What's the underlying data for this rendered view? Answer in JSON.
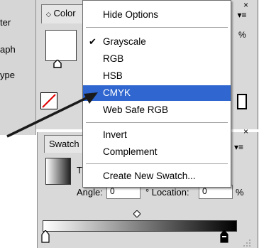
{
  "left_strip": {
    "items": [
      "ter",
      "aph",
      "ype"
    ]
  },
  "color_panel": {
    "tab_label": "Color",
    "percent": "%",
    "menu_glyph": "▾≡",
    "close_glyph": "×"
  },
  "menu": {
    "items": [
      {
        "label": "Hide Options",
        "checked": false,
        "active": false
      },
      {
        "label": "Grayscale",
        "checked": true,
        "active": false
      },
      {
        "label": "RGB",
        "checked": false,
        "active": false
      },
      {
        "label": "HSB",
        "checked": false,
        "active": false
      },
      {
        "label": "CMYK",
        "checked": false,
        "active": true
      },
      {
        "label": "Web Safe RGB",
        "checked": false,
        "active": false
      },
      {
        "label": "Invert",
        "checked": false,
        "active": false
      },
      {
        "label": "Complement",
        "checked": false,
        "active": false
      },
      {
        "label": "Create New Swatch...",
        "checked": false,
        "active": false
      }
    ],
    "check_glyph": "✔",
    "active_color": "#2f66cf"
  },
  "swatch_panel": {
    "tab_label": "Swatch",
    "type_label": "T",
    "angle_label": "Angle:",
    "angle_value": "0",
    "location_label": "° Location:",
    "location_value": "0",
    "percent": "%",
    "menu_glyph": "▾≡",
    "close_glyph": "×"
  },
  "icons": {
    "color_tab_icon": "diamond-arrows-icon",
    "swatch_tab_icon": "tab-icon"
  }
}
